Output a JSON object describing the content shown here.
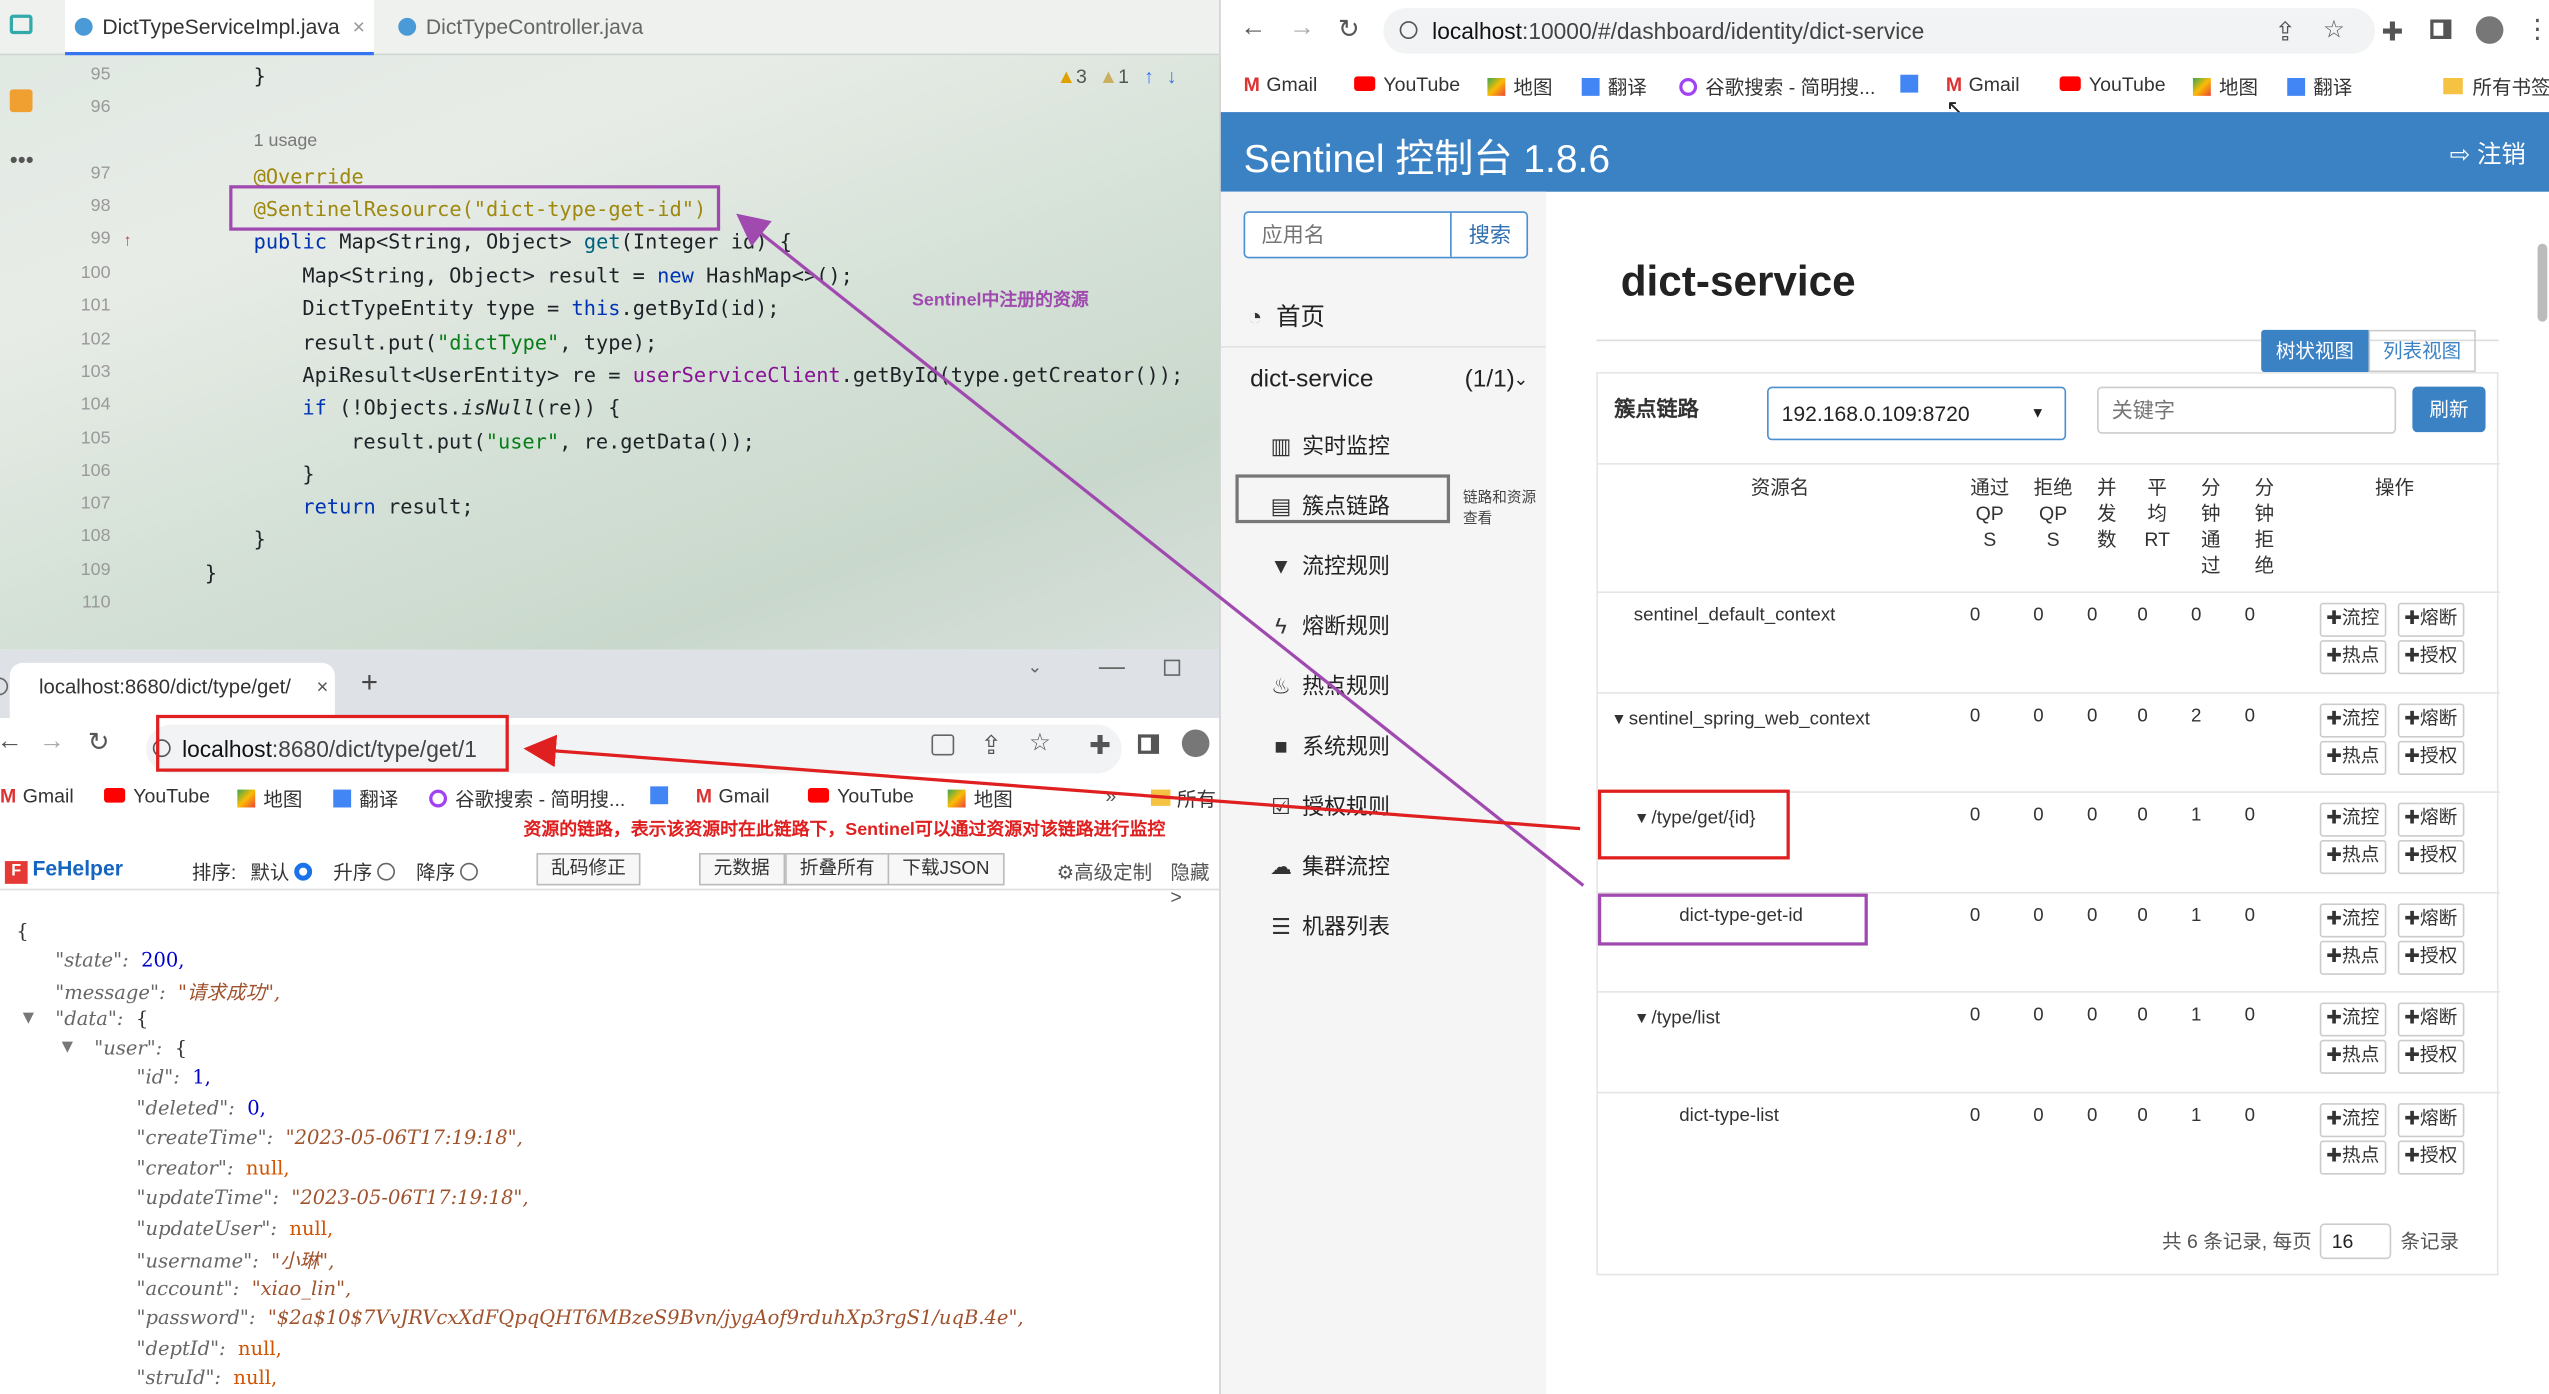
{
  "ide": {
    "tabs": [
      {
        "label": "DictTypeServiceImpl.java",
        "close": "×"
      },
      {
        "label": "DictTypeController.java"
      }
    ],
    "inspection": {
      "warnings": "3",
      "weak_warnings": "1"
    },
    "lines": [
      "95",
      "96",
      "97",
      "98",
      "99",
      "100",
      "101",
      "102",
      "103",
      "104",
      "105",
      "106",
      "107",
      "108",
      "109",
      "110"
    ],
    "usage": "1 usage",
    "code": {
      "brace_95": "}",
      "override": "@Override",
      "sentinel_anno": "@SentinelResource(\"dict-type-get-id\")",
      "l99": "public Map<String, Object> get(Integer id) {",
      "l100": "Map<String, Object> result = new HashMap<>();",
      "l101": "DictTypeEntity type = this.getById(id);",
      "l102": "result.put(\"dictType\", type);",
      "l103": "ApiResult<UserEntity> re = userServiceClient.getById(type.getCreator());",
      "l104": "if (!Objects.isNull(re)) {",
      "l105": "result.put(\"user\", re.getData());",
      "l106": "}",
      "l107": "return result;",
      "l108": "}",
      "l109": "}"
    },
    "annotation_note": "Sentinel中注册的资源"
  },
  "left_browser": {
    "tab_title": "localhost:8680/dict/type/get/",
    "url_host": "localhost",
    "url_rest": ":8680/dict/type/get/1",
    "bookmarks": [
      "Gmail",
      "YouTube",
      "地图",
      "翻译",
      "谷歌搜索 - 简明搜...",
      "Gmail",
      "YouTube",
      "地图",
      "所有"
    ],
    "note": "资源的链路，表示该资源时在此链路下，Sentinel可以通过资源对该链路进行监控",
    "fehelper": {
      "brand": "FeHelper",
      "sort_label": "排序:",
      "sort_default": "默认",
      "sort_asc": "升序",
      "sort_desc": "降序",
      "fix_btn": "乱码修正",
      "raw_btn": "元数据",
      "fold_btn": "折叠所有",
      "download_btn": "下载JSON",
      "custom_btn": "高级定制",
      "hide_btn": "隐藏>"
    },
    "json": {
      "open": "{",
      "state_key": "\"state\":",
      "state_val": "200,",
      "message_key": "\"message\":",
      "message_val": "\"请求成功\",",
      "data_key": "\"data\":",
      "data_open": "{",
      "user_key": "\"user\":",
      "user_open": "{",
      "fields": [
        {
          "k": "\"id\":",
          "v": "1,",
          "t": "n"
        },
        {
          "k": "\"deleted\":",
          "v": "0,",
          "t": "n"
        },
        {
          "k": "\"createTime\":",
          "v": "\"2023-05-06T17:19:18\",",
          "t": "s"
        },
        {
          "k": "\"creator\":",
          "v": "null,",
          "t": "null"
        },
        {
          "k": "\"updateTime\":",
          "v": "\"2023-05-06T17:19:18\",",
          "t": "s"
        },
        {
          "k": "\"updateUser\":",
          "v": "null,",
          "t": "null"
        },
        {
          "k": "\"username\":",
          "v": "\"小琳\",",
          "t": "s"
        },
        {
          "k": "\"account\":",
          "v": "\"xiao_lin\",",
          "t": "s"
        },
        {
          "k": "\"password\":",
          "v": "\"$2a$10$7VvJRVcxXdFQpqQHT6MBzeS9Bvn/jygAof9rduhXp3rgS1/uqB.4e\",",
          "t": "s"
        },
        {
          "k": "\"deptId\":",
          "v": "null,",
          "t": "null"
        },
        {
          "k": "\"struId\":",
          "v": "null,",
          "t": "null"
        }
      ]
    }
  },
  "right_browser": {
    "url_host": "localhost",
    "url_rest": ":10000/#/dashboard/identity/dict-service",
    "bookmarks": [
      "Gmail",
      "YouTube",
      "地图",
      "翻译",
      "谷歌搜索 - 简明搜...",
      "Gmail",
      "YouTube",
      "地图",
      "翻译",
      "所有书签"
    ],
    "sentinel": {
      "title": "Sentinel 控制台 1.8.6",
      "logout": "注销",
      "app_placeholder": "应用名",
      "search_btn": "搜索",
      "home": "首页",
      "app_name": "dict-service",
      "app_count": "(1/1)",
      "menu": [
        "实时监控",
        "簇点链路",
        "流控规则",
        "熔断规则",
        "热点规则",
        "系统规则",
        "授权规则",
        "集群流控",
        "机器列表"
      ],
      "side_note": "链路和资源查看",
      "page_title": "dict-service",
      "tree_view": "树状视图",
      "list_view": "列表视图",
      "chain_label": "簇点链路",
      "machine": "192.168.0.109:8720",
      "keyword_placeholder": "关键字",
      "refresh": "刷新",
      "headers": {
        "resource": "资源名",
        "pass_qps": "通过\nQP\nS",
        "block_qps": "拒绝\nQP\nS",
        "concurrency": "并\n发\n数",
        "avg_rt": "平\n均\nRT",
        "min_pass": "分\n钟\n通\n过",
        "min_block": "分\n钟\n拒\n绝",
        "ops": "操作"
      },
      "rows": [
        {
          "name": "sentinel_default_context",
          "vals": [
            "0",
            "0",
            "0",
            "0",
            "0",
            "0"
          ]
        },
        {
          "name": "sentinel_spring_web_context",
          "vals": [
            "0",
            "0",
            "0",
            "0",
            "2",
            "0"
          ]
        },
        {
          "name": "/type/get/{id}",
          "vals": [
            "0",
            "0",
            "0",
            "0",
            "1",
            "0"
          ]
        },
        {
          "name": "dict-type-get-id",
          "vals": [
            "0",
            "0",
            "0",
            "0",
            "1",
            "0"
          ]
        },
        {
          "name": "/type/list",
          "vals": [
            "0",
            "0",
            "0",
            "0",
            "1",
            "0"
          ]
        },
        {
          "name": "dict-type-list",
          "vals": [
            "0",
            "0",
            "0",
            "0",
            "1",
            "0"
          ]
        }
      ],
      "ops": {
        "flow": "流控",
        "degrade": "熔断",
        "hot": "热点",
        "auth": "授权"
      },
      "footer": {
        "prefix": "共 6 条记录, 每页",
        "page_size": "16",
        "suffix": "条记录"
      }
    }
  },
  "colors": {
    "sentinel_blue": "#3b82c4",
    "highlight_purple": "#a04ab0",
    "highlight_red": "#e02020"
  }
}
